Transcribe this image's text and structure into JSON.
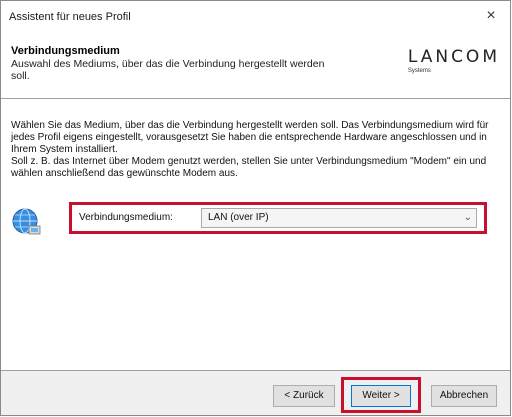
{
  "window": {
    "title": "Assistent für neues Profil",
    "close_glyph": "×"
  },
  "header": {
    "title": "Verbindungsmedium",
    "subtitle": "Auswahl des Mediums, über das die Verbindung hergestellt werden soll.",
    "logo_text": "LANCOM",
    "logo_subtext": "Systems"
  },
  "body": {
    "description": [
      "Wählen Sie das Medium, über das die Verbindung hergestellt werden soll. Das Verbindungsmedium wird für jedes Profil eigens eingestellt, vorausgesetzt Sie haben die entsprechende Hardware angeschlossen und in Ihrem System installiert.",
      "Soll z. B. das Internet über Modem genutzt werden, stellen Sie unter Verbindungsmedium \"Modem\" ein und wählen anschließend das gewünschte Modem aus."
    ],
    "medium_label": "Verbindungsmedium:",
    "medium_value": "LAN (over IP)",
    "medium_icon": "globe-network-icon"
  },
  "footer": {
    "back_label": "< Zurück",
    "next_label": "Weiter >",
    "cancel_label": "Abbrechen"
  },
  "colors": {
    "highlight": "#c8102e",
    "footer_bg": "#f0f0f0",
    "focus_border": "#0078d7"
  }
}
